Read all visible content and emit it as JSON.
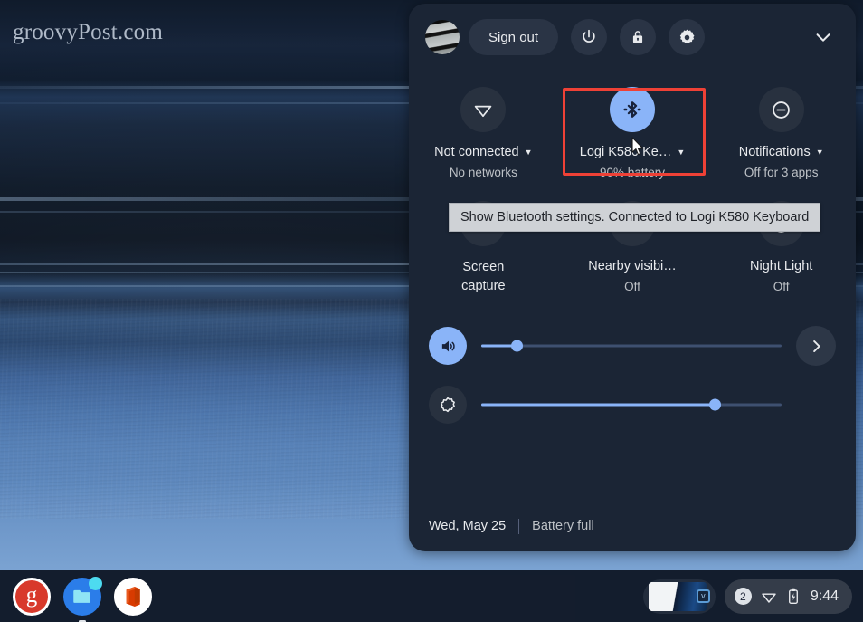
{
  "desktop": {
    "watermark": "groovyPost.com"
  },
  "quick_settings": {
    "header": {
      "avatar_name": "user-avatar",
      "sign_out_label": "Sign out",
      "power_icon": "power-icon",
      "lock_icon": "lock-icon",
      "settings_icon": "gear-icon",
      "collapse_icon": "chevron-down-icon"
    },
    "tiles_row_1": [
      {
        "icon": "wifi-icon",
        "label": "Not connected",
        "sub": "No networks",
        "has_caret": true,
        "active": false
      },
      {
        "icon": "bluetooth-icon",
        "label": "Logi K580 Ke…",
        "sub": "90% battery",
        "has_caret": true,
        "active": true,
        "highlighted": true
      },
      {
        "icon": "do-not-disturb-icon",
        "label": "Notifications",
        "sub": "Off for 3 apps",
        "has_caret": true,
        "active": false
      }
    ],
    "tiles_row_2": [
      {
        "icon": "screen-capture-icon",
        "label": "Screen\ncapture",
        "sub": "",
        "has_caret": false,
        "active": false
      },
      {
        "icon": "nearby-visibility-off-icon",
        "label": "Nearby visibi…",
        "sub": "Off",
        "has_caret": false,
        "active": false
      },
      {
        "icon": "night-light-icon",
        "label": "Night Light",
        "sub": "Off",
        "has_caret": false,
        "active": false
      }
    ],
    "tooltip": {
      "text": "Show Bluetooth settings. Connected to Logi K580 Keyboard"
    },
    "sliders": [
      {
        "name": "volume",
        "icon": "volume-icon",
        "value_percent": 12,
        "active": true,
        "has_next_button": true,
        "next_icon": "chevron-right-icon"
      },
      {
        "name": "brightness",
        "icon": "brightness-icon",
        "value_percent": 78,
        "active": false,
        "has_next_button": false,
        "next_icon": ""
      }
    ],
    "footer": {
      "date": "Wed, May 25",
      "battery_status": "Battery full"
    },
    "colors": {
      "panel_bg": "#1b2535",
      "accent": "#8ab4f8",
      "highlight_box": "#ef4136",
      "tile_bg": "#28313f",
      "text_primary": "#e8eaed",
      "text_secondary": "#bdc1c6"
    }
  },
  "shelf": {
    "apps": [
      {
        "name": "groovypost-app",
        "glyph": "g"
      },
      {
        "name": "files-app",
        "glyph": ""
      },
      {
        "name": "office-app",
        "glyph": ""
      }
    ],
    "window_preview": {
      "name": "window-preview",
      "badge": "v"
    },
    "status_tray": {
      "notification_count": "2",
      "wifi_icon": "wifi-icon",
      "battery_icon": "battery-icon",
      "time": "9:44"
    }
  }
}
